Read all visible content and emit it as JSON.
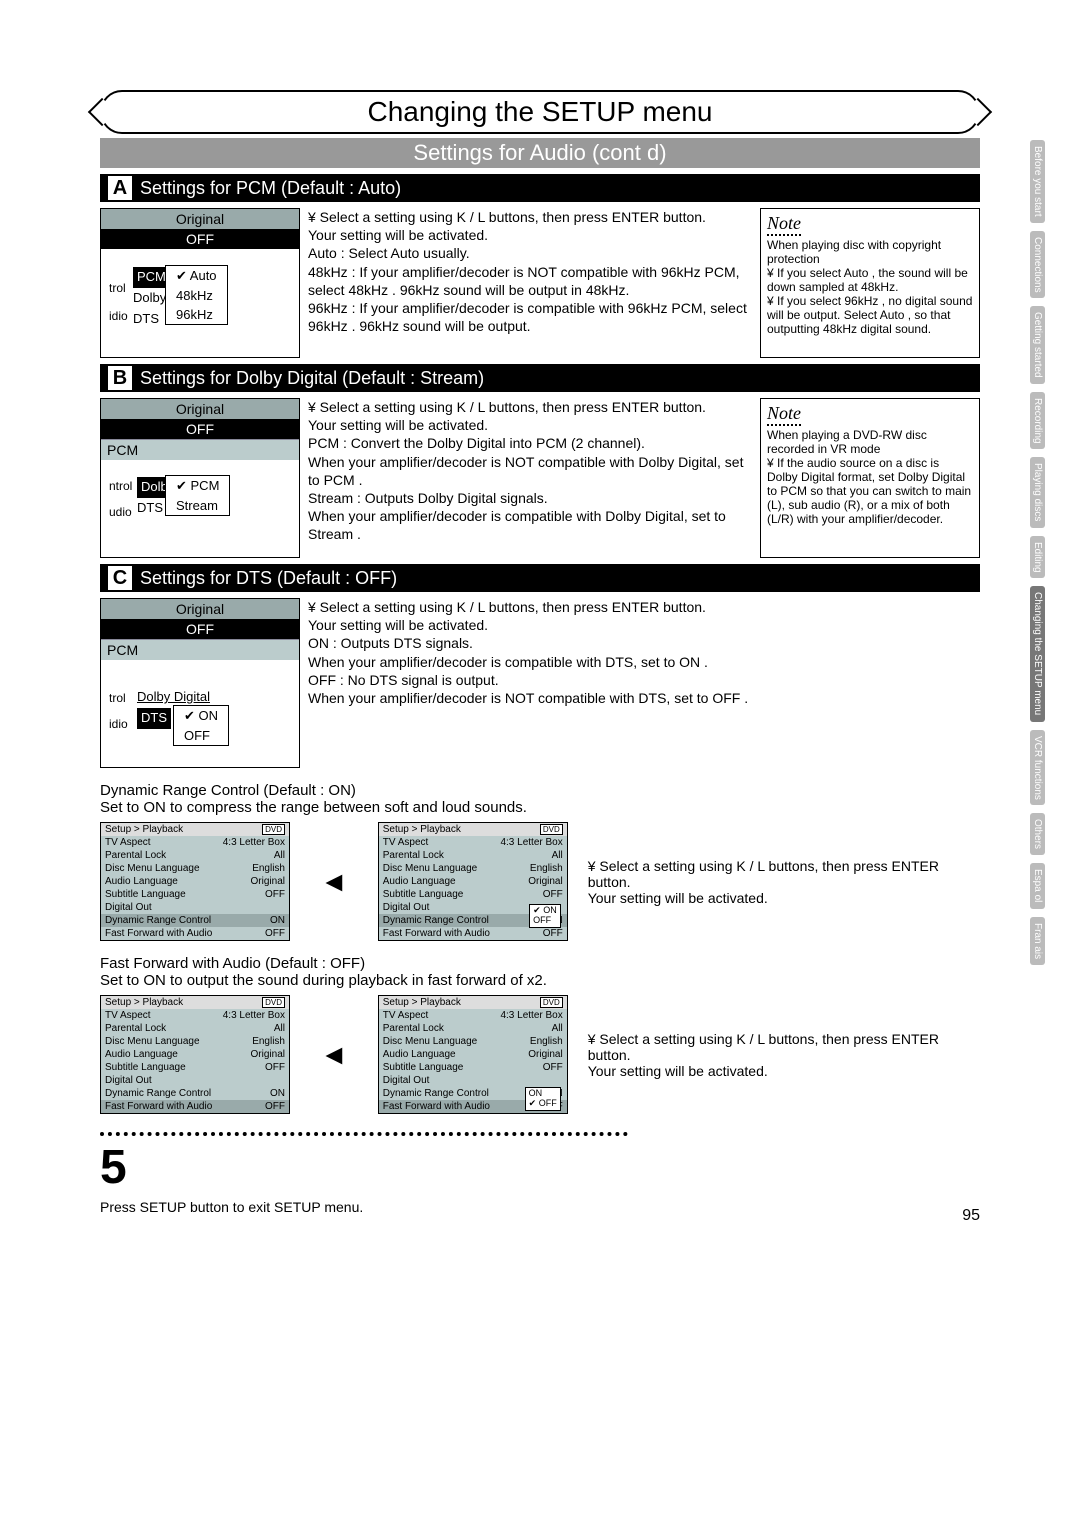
{
  "page_title": "Changing the SETUP menu",
  "subtitle": "Settings for Audio (cont d)",
  "page_number": "95",
  "sections": {
    "A": {
      "letter": "A",
      "heading": "Settings for PCM (Default : Auto)",
      "osd_top": "Original",
      "osd_off": "OFF",
      "osd_items": [
        "PCM",
        "Dolby",
        "DTS"
      ],
      "side_labels": [
        "trol",
        "idio"
      ],
      "submenu_sel": "Auto",
      "submenu": [
        "Auto",
        "48kHz",
        "96kHz"
      ],
      "desc": "¥ Select a setting using  K / L  buttons, then press ENTER button.\nYour setting will be activated.\nAuto       : Select  Auto  usually.\n48kHz    : If your amplifier/decoder is NOT compatible with 96kHz PCM, select  48kHz . 96kHz sound will be output in 48kHz.\n96kHz    : If your amplifier/decoder is compatible with 96kHz PCM, select  96kHz . 96kHz sound will be output.",
      "note_title": "Note",
      "note": "When playing disc with copyright protection\n¥ If you select  Auto , the sound will be down sampled at 48kHz.\n¥ If you select  96kHz , no digital sound will be output. Select  Auto , so that outputting 48kHz digital sound."
    },
    "B": {
      "letter": "B",
      "heading": "Settings for Dolby Digital (Default : Stream)",
      "osd_top": "Original",
      "osd_off": "OFF",
      "osd_list": [
        "PCM",
        "Dolby Digital",
        "DTS"
      ],
      "side_labels": [
        "ntrol",
        "udio"
      ],
      "submenu_sel": "PCM",
      "submenu": [
        "PCM",
        "Stream"
      ],
      "desc": "¥ Select a setting using  K / L  buttons, then press ENTER button.\nYour setting will be activated.\nPCM     : Convert the Dolby Digital into PCM (2 channel).\n            When your amplifier/decoder is NOT compatible with Dolby Digital, set to  PCM .\nStream : Outputs Dolby Digital signals.\n            When your amplifier/decoder is compatible with Dolby Digital, set to  Stream .",
      "note_title": "Note",
      "note": "When playing a DVD-RW disc recorded in VR mode\n¥ If the audio source on a disc is Dolby Digital format, set  Dolby Digital  to  PCM  so that you can switch to main (L), sub audio (R), or a mix of both (L/R) with your amplifier/decoder."
    },
    "C": {
      "letter": "C",
      "heading": "Settings for DTS (Default : OFF)",
      "osd_top": "Original",
      "osd_off": "OFF",
      "osd_list": [
        "PCM",
        "Dolby Digital",
        "DTS"
      ],
      "side_labels": [
        "trol",
        "idio"
      ],
      "submenu_sel": "ON",
      "submenu": [
        "ON",
        "OFF"
      ],
      "desc": "¥ Select a setting using  K / L  buttons, then press ENTER button.\nYour setting will be activated.\nON       : Outputs DTS signals.\n             When your amplifier/decoder is compatible with DTS, set to  ON .\nOFF     : No DTS signal is output.\n             When your amplifier/decoder is NOT compatible with DTS, set to  OFF ."
    }
  },
  "drc": {
    "title": "Dynamic Range Control (Default : ON)",
    "sub": "Set to ON to compress the range between soft and loud sounds.",
    "instr": "¥ Select a setting using  K / L buttons, then press ENTER button.\nYour setting will be activated."
  },
  "ffa": {
    "title": "Fast Forward with Audio (Default : OFF)",
    "sub": "Set to ON to output the sound during playback in fast forward of x2.",
    "instr": "¥ Select a setting using  K / L buttons, then press ENTER button.\nYour setting will be activated."
  },
  "playback_menu": {
    "crumb": "Setup > Playback",
    "badge": "DVD",
    "rows": [
      {
        "k": "TV Aspect",
        "v": "4:3 Letter Box"
      },
      {
        "k": "Parental Lock",
        "v": "All"
      },
      {
        "k": "Disc Menu Language",
        "v": "English"
      },
      {
        "k": "Audio Language",
        "v": "Original"
      },
      {
        "k": "Subtitle Language",
        "v": "OFF"
      },
      {
        "k": "Digital Out",
        "v": ""
      },
      {
        "k": "Dynamic Range Control",
        "v": "ON"
      },
      {
        "k": "Fast Forward with Audio",
        "v": "OFF"
      }
    ]
  },
  "drc_popup": {
    "opt1": "ON",
    "opt2": "OFF",
    "sel": "ON"
  },
  "ffa_popup": {
    "opt1": "ON",
    "opt2": "OFF",
    "sel": "OFF"
  },
  "step5": {
    "num": "5",
    "text": "Press SETUP button to exit SETUP menu."
  },
  "tabs": [
    "Before you start",
    "Connections",
    "Getting started",
    "Recording",
    "Playing discs",
    "Editing",
    "Changing the SETUP menu",
    "VCR functions",
    "Others",
    "Espa ol",
    "Fran ais"
  ],
  "active_tab": 6
}
